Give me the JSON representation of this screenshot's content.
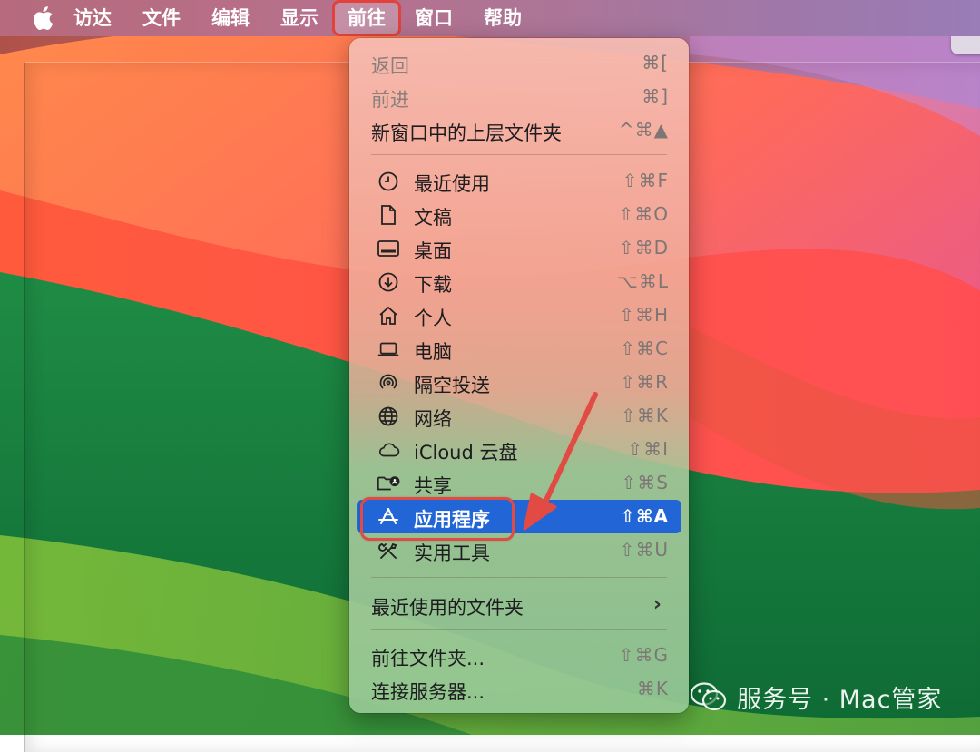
{
  "menubar": {
    "apple_icon": "apple-logo",
    "items": [
      "访达",
      "文件",
      "编辑",
      "显示",
      "前往",
      "窗口",
      "帮助"
    ],
    "active_index": 4
  },
  "menu": {
    "nav": [
      {
        "label": "返回",
        "shortcut": "⌘[",
        "enabled": false
      },
      {
        "label": "前进",
        "shortcut": "⌘]",
        "enabled": false
      },
      {
        "label": "新窗口中的上层文件夹",
        "shortcut": "^⌘▲",
        "enabled": true
      }
    ],
    "locations": [
      {
        "label": "最近使用",
        "shortcut": "⇧⌘F",
        "icon": "clock-icon"
      },
      {
        "label": "文稿",
        "shortcut": "⇧⌘O",
        "icon": "document-icon"
      },
      {
        "label": "桌面",
        "shortcut": "⇧⌘D",
        "icon": "desktop-icon"
      },
      {
        "label": "下载",
        "shortcut": "⌥⌘L",
        "icon": "download-icon"
      },
      {
        "label": "个人",
        "shortcut": "⇧⌘H",
        "icon": "home-icon"
      },
      {
        "label": "电脑",
        "shortcut": "⇧⌘C",
        "icon": "laptop-icon"
      },
      {
        "label": "隔空投送",
        "shortcut": "⇧⌘R",
        "icon": "airdrop-icon"
      },
      {
        "label": "网络",
        "shortcut": "⇧⌘K",
        "icon": "globe-icon"
      },
      {
        "label": "iCloud 云盘",
        "shortcut": "⇧⌘I",
        "icon": "cloud-icon"
      },
      {
        "label": "共享",
        "shortcut": "⇧⌘S",
        "icon": "shared-folder-icon"
      },
      {
        "label": "应用程序",
        "shortcut": "⇧⌘A",
        "icon": "applications-icon",
        "highlighted": true
      },
      {
        "label": "实用工具",
        "shortcut": "⇧⌘U",
        "icon": "utilities-icon"
      }
    ],
    "recent_folders": {
      "label": "最近使用的文件夹",
      "submenu_indicator": "›"
    },
    "bottom": [
      {
        "label": "前往文件夹...",
        "shortcut": "⇧⌘G"
      },
      {
        "label": "连接服务器...",
        "shortcut": "⌘K"
      }
    ]
  },
  "watermark": {
    "text": "服务号 · Mac管家"
  },
  "colors": {
    "highlight": "#2265d6",
    "annotation": "#e24a44",
    "menubar_start": "#b66a7c",
    "menubar_end": "#9a7cb6"
  }
}
